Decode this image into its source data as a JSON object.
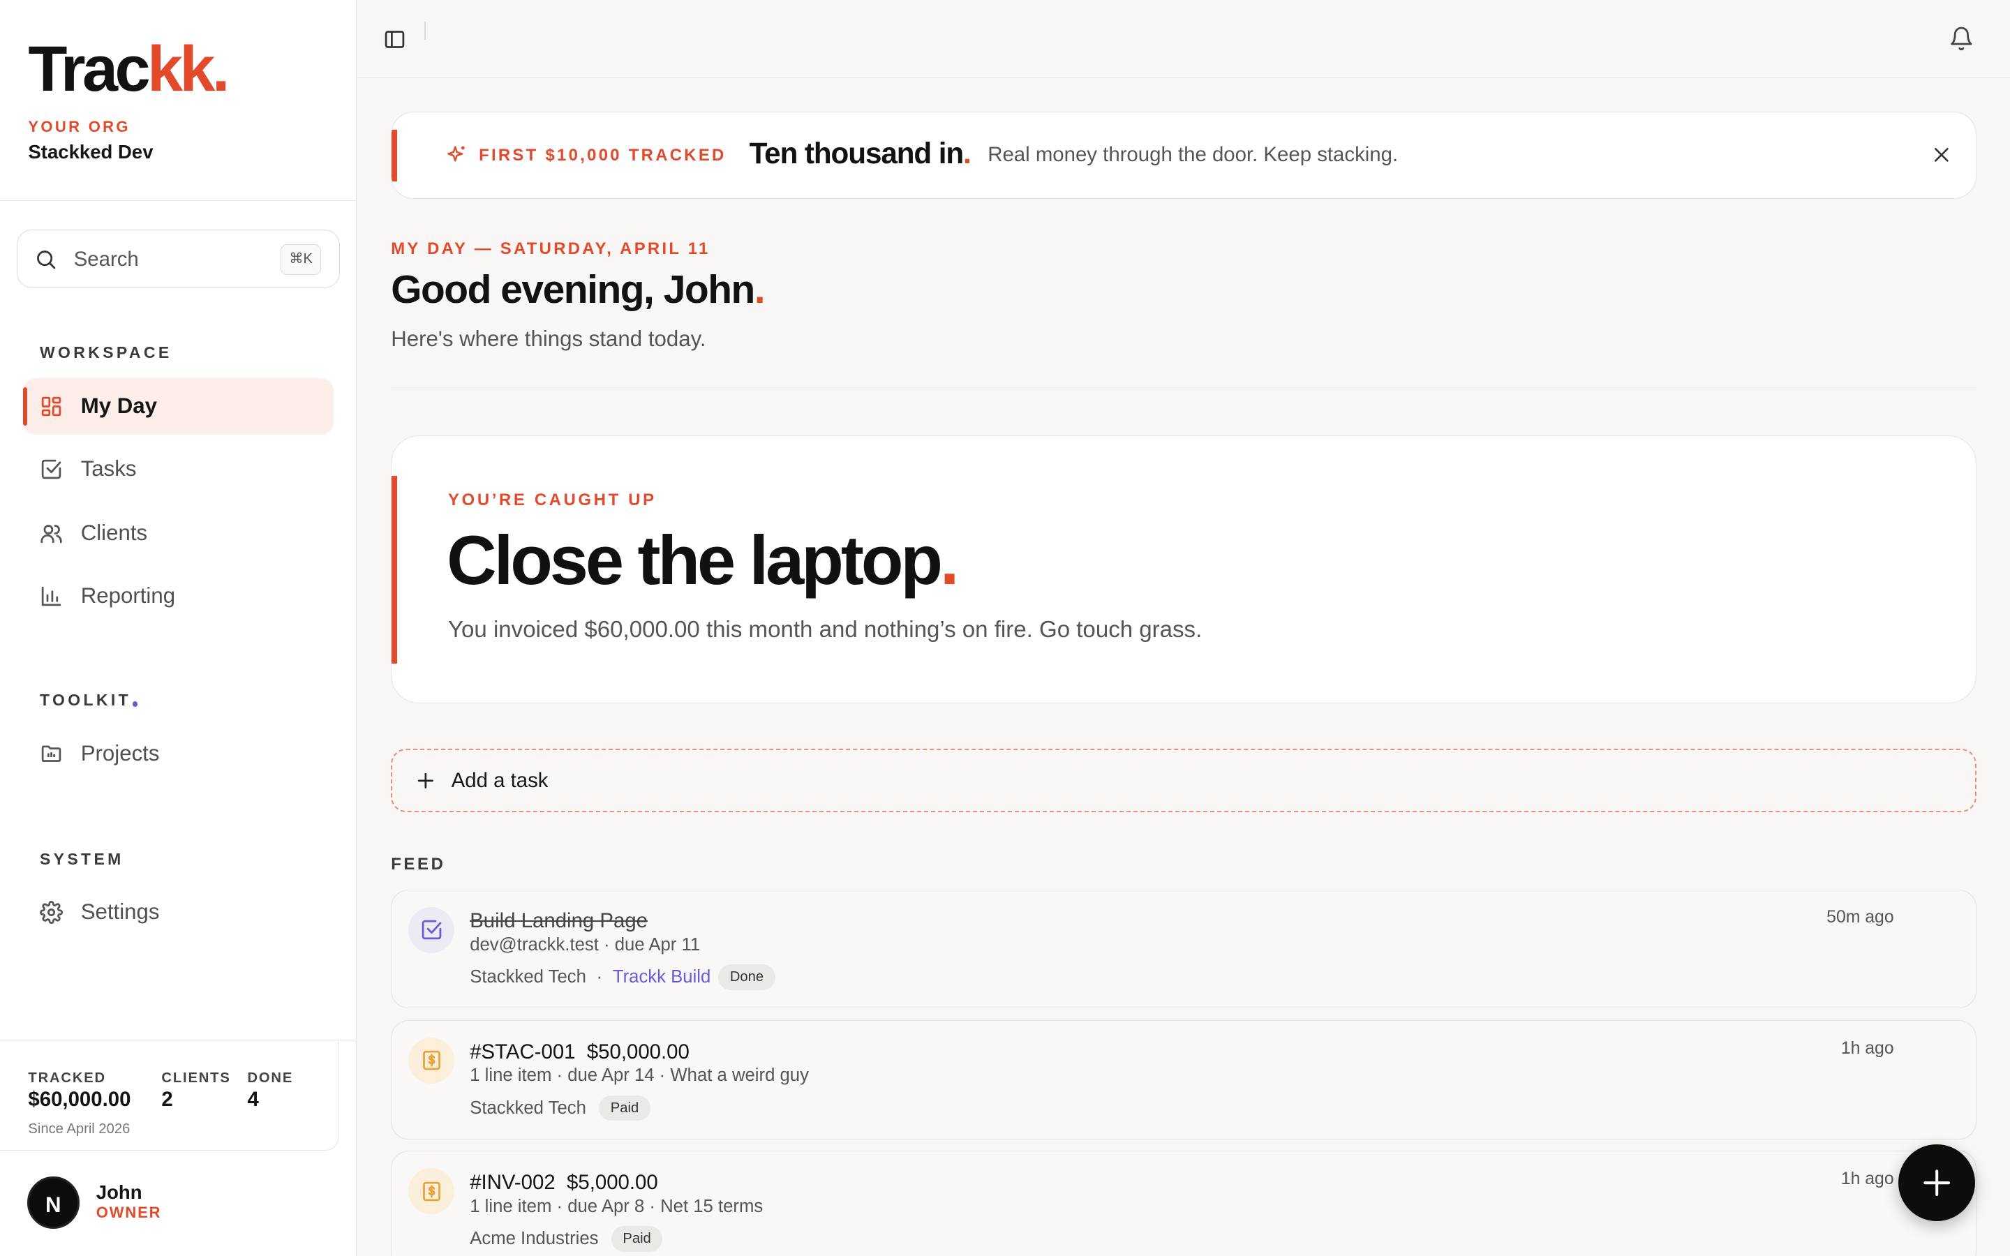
{
  "brand": {
    "name_main": "Trac",
    "name_accent": "kk",
    "name_dot": "."
  },
  "org": {
    "label": "YOUR ORG",
    "name": "Stackked Dev"
  },
  "search": {
    "placeholder": "Search",
    "shortcut": "⌘K"
  },
  "nav": {
    "workspace_label": "WORKSPACE",
    "workspace_items": [
      {
        "label": "My Day",
        "icon": "grid-icon",
        "active": true
      },
      {
        "label": "Tasks",
        "icon": "checkbox-icon"
      },
      {
        "label": "Clients",
        "icon": "users-icon"
      },
      {
        "label": "Reporting",
        "icon": "bar-chart-icon"
      }
    ],
    "toolkit_label": "TOOLKIT",
    "toolkit_items": [
      {
        "label": "Projects",
        "icon": "folder-icon"
      }
    ],
    "system_label": "SYSTEM",
    "system_items": [
      {
        "label": "Settings",
        "icon": "gear-icon"
      }
    ]
  },
  "stats": {
    "tracked_label": "TRACKED",
    "tracked_value": "$60,000.00",
    "clients_label": "CLIENTS",
    "clients_value": "2",
    "done_label": "DONE",
    "done_value": "4",
    "since": "Since April 2026"
  },
  "user": {
    "initial": "N",
    "name": "John",
    "role": "OWNER"
  },
  "banner": {
    "tag": "FIRST $10,000 TRACKED",
    "headline": "Ten thousand in",
    "headline_dot": ".",
    "message": "Real money through the door. Keep stacking."
  },
  "header": {
    "eyebrow": "MY DAY — SATURDAY, APRIL 11",
    "greeting": "Good evening, John",
    "greeting_dot": ".",
    "subtitle": "Here's where things stand today."
  },
  "hero": {
    "eyebrow": "YOU’RE CAUGHT UP",
    "title": "Close the laptop",
    "title_dot": ".",
    "message": "You invoiced $60,000.00 this month and nothing’s on fire. Go touch grass."
  },
  "add_task": {
    "label": "Add a task"
  },
  "feed": {
    "label": "FEED",
    "items": [
      {
        "title": "Build Landing Page",
        "sub": "dev@trackk.test · due Apr 11",
        "client": "Stackked Tech",
        "sep": "·",
        "project": "Trackk Build",
        "badge": "Done",
        "time": "50m ago",
        "icon": "task-check-icon"
      },
      {
        "title": "#STAC-001  $50,000.00",
        "sub": "1 line item · due Apr 14 · What a weird guy",
        "client": "Stackked Tech",
        "badge": "Paid",
        "time": "1h ago",
        "icon": "invoice-icon"
      },
      {
        "title": "#INV-002  $5,000.00",
        "sub": "1 line item · due Apr 8 · Net 15 terms",
        "client": "Acme Industries",
        "badge": "Paid",
        "time": "1h ago",
        "icon": "invoice-icon"
      }
    ]
  },
  "colors": {
    "accent": "#e24a2b",
    "project_link": "#6a5ad8",
    "invoice_icon": "#e8a33a",
    "task_icon": "#6a5ad8"
  }
}
